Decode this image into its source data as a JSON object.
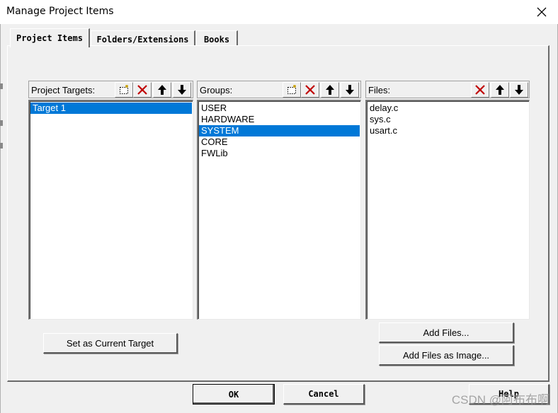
{
  "window": {
    "title": "Manage Project Items"
  },
  "tabs": [
    {
      "label": "Project Items",
      "active": true
    },
    {
      "label": "Folders/Extensions",
      "active": false
    },
    {
      "label": "Books",
      "active": false
    }
  ],
  "targets": {
    "header": "Project Targets:",
    "items": [
      "Target 1"
    ],
    "selected_index": 0
  },
  "groups": {
    "header": "Groups:",
    "items": [
      "USER",
      "HARDWARE",
      "SYSTEM",
      "CORE",
      "FWLib"
    ],
    "selected_index": 2
  },
  "files": {
    "header": "Files:",
    "items": [
      "delay.c",
      "sys.c",
      "usart.c"
    ]
  },
  "buttons": {
    "set_current_target": "Set as Current Target",
    "add_files": "Add Files...",
    "add_files_image": "Add Files as Image...",
    "ok": "OK",
    "cancel": "Cancel",
    "help": "Help"
  },
  "watermark": "CSDN @阿布布啊",
  "colors": {
    "selection": "#0078d7",
    "delete_icon": "#c00000",
    "dialog_bg": "#f0f0f0"
  },
  "icons": [
    "new-item-icon",
    "delete-icon",
    "move-up-icon",
    "move-down-icon",
    "close-icon"
  ]
}
